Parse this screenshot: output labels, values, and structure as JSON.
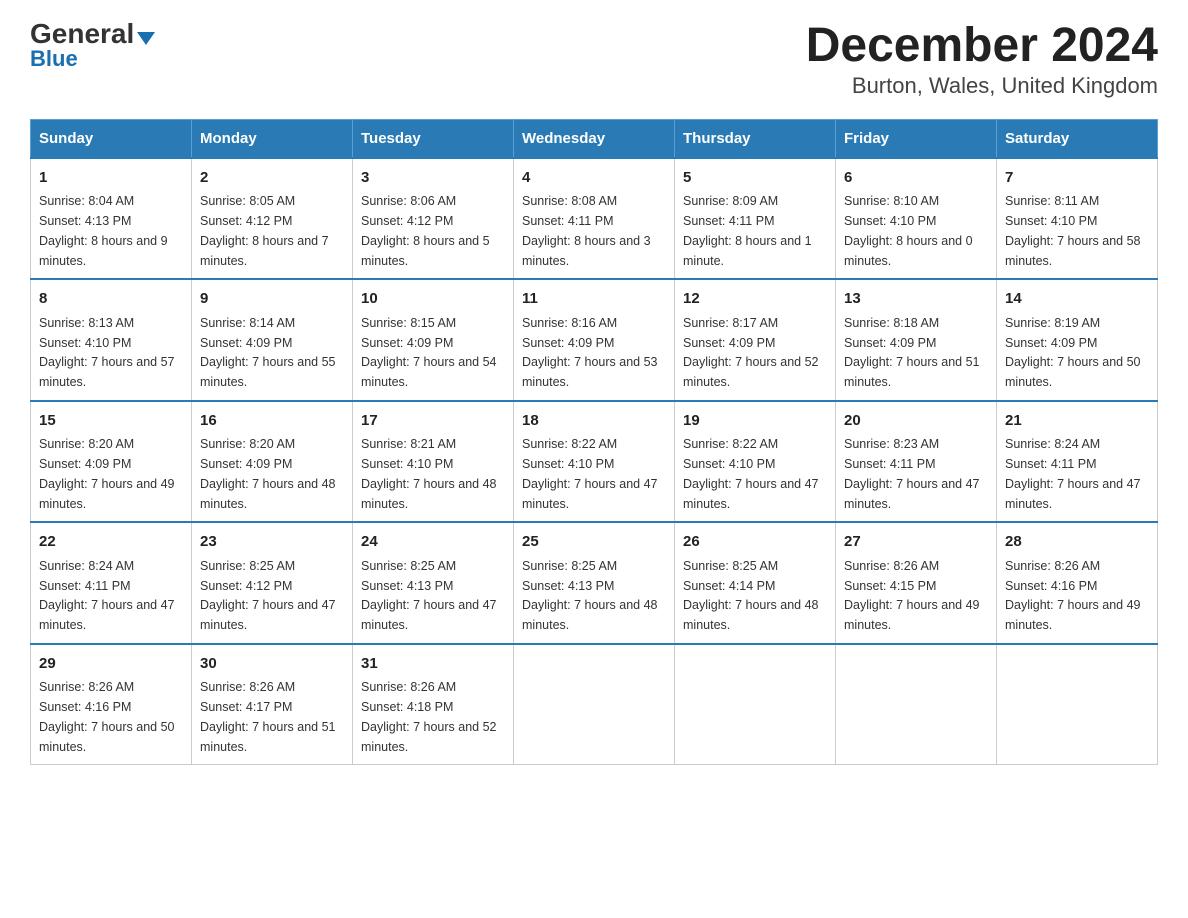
{
  "logo": {
    "general": "General",
    "blue": "Blue",
    "triangle": "▲"
  },
  "header": {
    "title": "December 2024",
    "subtitle": "Burton, Wales, United Kingdom"
  },
  "days_of_week": [
    "Sunday",
    "Monday",
    "Tuesday",
    "Wednesday",
    "Thursday",
    "Friday",
    "Saturday"
  ],
  "weeks": [
    [
      {
        "day": "1",
        "sunrise": "8:04 AM",
        "sunset": "4:13 PM",
        "daylight": "8 hours and 9 minutes."
      },
      {
        "day": "2",
        "sunrise": "8:05 AM",
        "sunset": "4:12 PM",
        "daylight": "8 hours and 7 minutes."
      },
      {
        "day": "3",
        "sunrise": "8:06 AM",
        "sunset": "4:12 PM",
        "daylight": "8 hours and 5 minutes."
      },
      {
        "day": "4",
        "sunrise": "8:08 AM",
        "sunset": "4:11 PM",
        "daylight": "8 hours and 3 minutes."
      },
      {
        "day": "5",
        "sunrise": "8:09 AM",
        "sunset": "4:11 PM",
        "daylight": "8 hours and 1 minute."
      },
      {
        "day": "6",
        "sunrise": "8:10 AM",
        "sunset": "4:10 PM",
        "daylight": "8 hours and 0 minutes."
      },
      {
        "day": "7",
        "sunrise": "8:11 AM",
        "sunset": "4:10 PM",
        "daylight": "7 hours and 58 minutes."
      }
    ],
    [
      {
        "day": "8",
        "sunrise": "8:13 AM",
        "sunset": "4:10 PM",
        "daylight": "7 hours and 57 minutes."
      },
      {
        "day": "9",
        "sunrise": "8:14 AM",
        "sunset": "4:09 PM",
        "daylight": "7 hours and 55 minutes."
      },
      {
        "day": "10",
        "sunrise": "8:15 AM",
        "sunset": "4:09 PM",
        "daylight": "7 hours and 54 minutes."
      },
      {
        "day": "11",
        "sunrise": "8:16 AM",
        "sunset": "4:09 PM",
        "daylight": "7 hours and 53 minutes."
      },
      {
        "day": "12",
        "sunrise": "8:17 AM",
        "sunset": "4:09 PM",
        "daylight": "7 hours and 52 minutes."
      },
      {
        "day": "13",
        "sunrise": "8:18 AM",
        "sunset": "4:09 PM",
        "daylight": "7 hours and 51 minutes."
      },
      {
        "day": "14",
        "sunrise": "8:19 AM",
        "sunset": "4:09 PM",
        "daylight": "7 hours and 50 minutes."
      }
    ],
    [
      {
        "day": "15",
        "sunrise": "8:20 AM",
        "sunset": "4:09 PM",
        "daylight": "7 hours and 49 minutes."
      },
      {
        "day": "16",
        "sunrise": "8:20 AM",
        "sunset": "4:09 PM",
        "daylight": "7 hours and 48 minutes."
      },
      {
        "day": "17",
        "sunrise": "8:21 AM",
        "sunset": "4:10 PM",
        "daylight": "7 hours and 48 minutes."
      },
      {
        "day": "18",
        "sunrise": "8:22 AM",
        "sunset": "4:10 PM",
        "daylight": "7 hours and 47 minutes."
      },
      {
        "day": "19",
        "sunrise": "8:22 AM",
        "sunset": "4:10 PM",
        "daylight": "7 hours and 47 minutes."
      },
      {
        "day": "20",
        "sunrise": "8:23 AM",
        "sunset": "4:11 PM",
        "daylight": "7 hours and 47 minutes."
      },
      {
        "day": "21",
        "sunrise": "8:24 AM",
        "sunset": "4:11 PM",
        "daylight": "7 hours and 47 minutes."
      }
    ],
    [
      {
        "day": "22",
        "sunrise": "8:24 AM",
        "sunset": "4:11 PM",
        "daylight": "7 hours and 47 minutes."
      },
      {
        "day": "23",
        "sunrise": "8:25 AM",
        "sunset": "4:12 PM",
        "daylight": "7 hours and 47 minutes."
      },
      {
        "day": "24",
        "sunrise": "8:25 AM",
        "sunset": "4:13 PM",
        "daylight": "7 hours and 47 minutes."
      },
      {
        "day": "25",
        "sunrise": "8:25 AM",
        "sunset": "4:13 PM",
        "daylight": "7 hours and 48 minutes."
      },
      {
        "day": "26",
        "sunrise": "8:25 AM",
        "sunset": "4:14 PM",
        "daylight": "7 hours and 48 minutes."
      },
      {
        "day": "27",
        "sunrise": "8:26 AM",
        "sunset": "4:15 PM",
        "daylight": "7 hours and 49 minutes."
      },
      {
        "day": "28",
        "sunrise": "8:26 AM",
        "sunset": "4:16 PM",
        "daylight": "7 hours and 49 minutes."
      }
    ],
    [
      {
        "day": "29",
        "sunrise": "8:26 AM",
        "sunset": "4:16 PM",
        "daylight": "7 hours and 50 minutes."
      },
      {
        "day": "30",
        "sunrise": "8:26 AM",
        "sunset": "4:17 PM",
        "daylight": "7 hours and 51 minutes."
      },
      {
        "day": "31",
        "sunrise": "8:26 AM",
        "sunset": "4:18 PM",
        "daylight": "7 hours and 52 minutes."
      },
      null,
      null,
      null,
      null
    ]
  ],
  "labels": {
    "sunrise": "Sunrise:",
    "sunset": "Sunset:",
    "daylight": "Daylight:"
  }
}
